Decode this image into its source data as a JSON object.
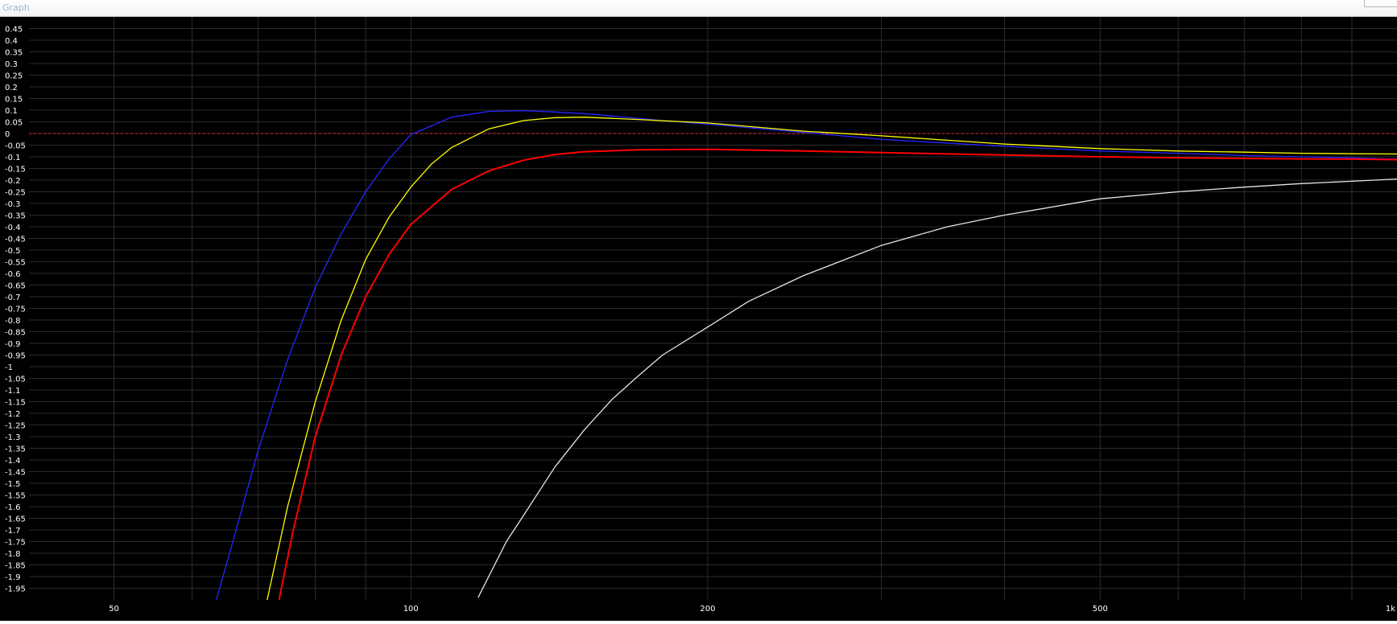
{
  "window": {
    "title": "Graph"
  },
  "chart_data": {
    "type": "line",
    "x_scale": "log",
    "xlim": [
      41,
      1000
    ],
    "ylim": [
      -2.0,
      0.5
    ],
    "x_ticks": [
      {
        "value": 50,
        "label": "50"
      },
      {
        "value": 100,
        "label": "100"
      },
      {
        "value": 200,
        "label": "200"
      },
      {
        "value": 500,
        "label": "500"
      },
      {
        "value": 1000,
        "label": "1k"
      }
    ],
    "x_gridlines": [
      50,
      60,
      70,
      80,
      90,
      100,
      200,
      300,
      400,
      500,
      600,
      700,
      800,
      900
    ],
    "y_ticks": [
      {
        "value": 0.45,
        "label": "0.45"
      },
      {
        "value": 0.4,
        "label": "0.4"
      },
      {
        "value": 0.35,
        "label": "0.35"
      },
      {
        "value": 0.3,
        "label": "0.3"
      },
      {
        "value": 0.25,
        "label": "0.25"
      },
      {
        "value": 0.2,
        "label": "0.2"
      },
      {
        "value": 0.15,
        "label": "0.15"
      },
      {
        "value": 0.1,
        "label": "0.1"
      },
      {
        "value": 0.05,
        "label": "0.05"
      },
      {
        "value": 0,
        "label": "0"
      },
      {
        "value": -0.05,
        "label": "-0.05"
      },
      {
        "value": -0.1,
        "label": "-0.1"
      },
      {
        "value": -0.15,
        "label": "-0.15"
      },
      {
        "value": -0.2,
        "label": "-0.2"
      },
      {
        "value": -0.25,
        "label": "-0.25"
      },
      {
        "value": -0.3,
        "label": "-0.3"
      },
      {
        "value": -0.35,
        "label": "-0.35"
      },
      {
        "value": -0.4,
        "label": "-0.4"
      },
      {
        "value": -0.45,
        "label": "-0.45"
      },
      {
        "value": -0.5,
        "label": "-0.5"
      },
      {
        "value": -0.55,
        "label": "-0.55"
      },
      {
        "value": -0.6,
        "label": "-0.6"
      },
      {
        "value": -0.65,
        "label": "-0.65"
      },
      {
        "value": -0.7,
        "label": "-0.7"
      },
      {
        "value": -0.75,
        "label": "-0.75"
      },
      {
        "value": -0.8,
        "label": "-0.8"
      },
      {
        "value": -0.85,
        "label": "-0.85"
      },
      {
        "value": -0.9,
        "label": "-0.9"
      },
      {
        "value": -0.95,
        "label": "-0.95"
      },
      {
        "value": -1,
        "label": "-1"
      },
      {
        "value": -1.05,
        "label": "-1.05"
      },
      {
        "value": -1.1,
        "label": "-1.1"
      },
      {
        "value": -1.15,
        "label": "-1.15"
      },
      {
        "value": -1.2,
        "label": "-1.2"
      },
      {
        "value": -1.25,
        "label": "-1.25"
      },
      {
        "value": -1.3,
        "label": "-1.3"
      },
      {
        "value": -1.35,
        "label": "-1.35"
      },
      {
        "value": -1.4,
        "label": "-1.4"
      },
      {
        "value": -1.45,
        "label": "-1.45"
      },
      {
        "value": -1.5,
        "label": "-1.5"
      },
      {
        "value": -1.55,
        "label": "-1.55"
      },
      {
        "value": -1.6,
        "label": "-1.6"
      },
      {
        "value": -1.65,
        "label": "-1.65"
      },
      {
        "value": -1.7,
        "label": "-1.7"
      },
      {
        "value": -1.75,
        "label": "-1.75"
      },
      {
        "value": -1.8,
        "label": "-1.8"
      },
      {
        "value": -1.85,
        "label": "-1.85"
      },
      {
        "value": -1.9,
        "label": "-1.9"
      },
      {
        "value": -1.95,
        "label": "-1.95"
      }
    ],
    "reference_line": {
      "y": 0,
      "color": "#ff2020",
      "style": "dashed"
    },
    "grid": true,
    "legend": "none",
    "colors": {
      "background": "#000000",
      "grid": "#2c2c2c",
      "tick_text": "#ffffff"
    },
    "series": [
      {
        "color": "#2626ff",
        "x": [
          63.5,
          66,
          70,
          75,
          80,
          85,
          90,
          95,
          100,
          110,
          120,
          130,
          140,
          150,
          160,
          180,
          200,
          250,
          300,
          400,
          500,
          600,
          700,
          800,
          900,
          1000
        ],
        "y": [
          -2.0,
          -1.75,
          -1.36,
          -0.97,
          -0.66,
          -0.43,
          -0.25,
          -0.11,
          -0.005,
          0.07,
          0.095,
          0.098,
          0.092,
          0.085,
          0.075,
          0.055,
          0.04,
          0.005,
          -0.025,
          -0.055,
          -0.075,
          -0.085,
          -0.095,
          -0.1,
          -0.105,
          -0.11
        ]
      },
      {
        "color": "#ffff00",
        "x": [
          71.5,
          75,
          80,
          85,
          90,
          95,
          100,
          105,
          110,
          120,
          130,
          140,
          150,
          170,
          200,
          250,
          300,
          400,
          500,
          600,
          700,
          800,
          900,
          1000
        ],
        "y": [
          -2.0,
          -1.6,
          -1.15,
          -0.8,
          -0.54,
          -0.36,
          -0.23,
          -0.13,
          -0.06,
          0.02,
          0.055,
          0.068,
          0.07,
          0.06,
          0.045,
          0.01,
          -0.01,
          -0.045,
          -0.065,
          -0.075,
          -0.08,
          -0.085,
          -0.087,
          -0.088
        ]
      },
      {
        "color": "#ff0000",
        "x": [
          73.5,
          76,
          80,
          85,
          90,
          95,
          100,
          110,
          120,
          130,
          140,
          150,
          170,
          200,
          250,
          300,
          400,
          500,
          600,
          700,
          800,
          900,
          1000
        ],
        "y": [
          -2.0,
          -1.7,
          -1.3,
          -0.95,
          -0.7,
          -0.52,
          -0.39,
          -0.24,
          -0.16,
          -0.115,
          -0.09,
          -0.078,
          -0.07,
          -0.068,
          -0.075,
          -0.082,
          -0.092,
          -0.1,
          -0.104,
          -0.107,
          -0.109,
          -0.11,
          -0.112
        ]
      },
      {
        "color": "#e6e6e6",
        "x": [
          117,
          125,
          130,
          140,
          150,
          160,
          170,
          180,
          200,
          220,
          250,
          300,
          350,
          400,
          500,
          600,
          700,
          800,
          900,
          1000
        ],
        "y": [
          -1.99,
          -1.75,
          -1.64,
          -1.43,
          -1.27,
          -1.14,
          -1.04,
          -0.95,
          -0.83,
          -0.72,
          -0.61,
          -0.48,
          -0.4,
          -0.35,
          -0.28,
          -0.25,
          -0.23,
          -0.215,
          -0.205,
          -0.195
        ]
      }
    ]
  }
}
